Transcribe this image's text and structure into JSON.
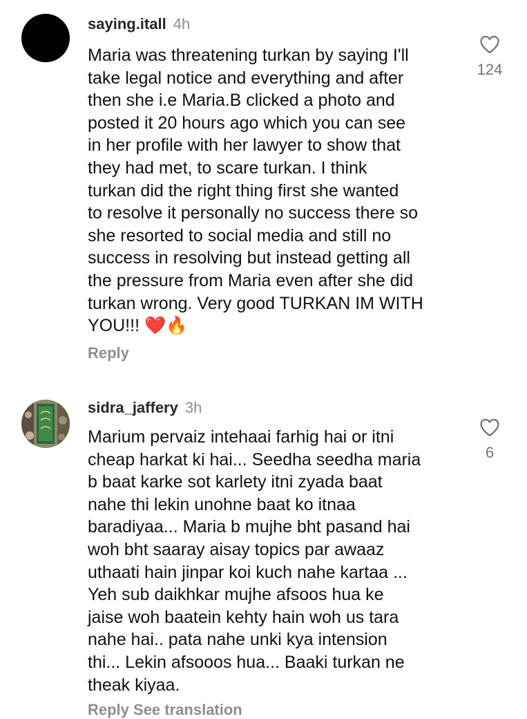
{
  "comments": [
    {
      "username": "saying.itall",
      "time": "4h",
      "avatar_color": "#000000",
      "lines": [
        "Maria was threatening turkan by saying I'll",
        "take legal notice and everything and after",
        "then she i.e Maria.B clicked a photo and",
        "posted it 20 hours ago which you can see",
        "in her profile with her lawyer to show that",
        "they had met, to scare turkan. I think",
        "turkan did the right thing first she wanted",
        "to resolve it personally no success there so",
        "she resorted to social media and still no",
        "success in resolving but instead getting all",
        "the pressure from Maria even after she did",
        "turkan wrong. Very good TURKAN IM WITH",
        "YOU!!! ❤️🔥"
      ],
      "reply_label": "Reply",
      "like_icon": "heart-outline-icon",
      "like_count": "124"
    },
    {
      "username": "sidra_jaffery",
      "time": "3h",
      "avatar_color": "#4a6b3a",
      "lines": [
        "Marium pervaiz intehaai farhig hai or itni",
        "cheap harkat ki hai... Seedha seedha maria",
        "b baat karke sot karlety itni zyada baat",
        "nahe thi lekin unohne baat ko itnaa",
        "baradiyaa... Maria b mujhe bht pasand hai",
        "woh bht saaray aisay topics par awaaz",
        "uthaati hain jinpar koi kuch nahe kartaa ...",
        "Yeh sub daikhkar mujhe afsoos hua ke",
        "jaise woh baatein kehty hain woh us tara",
        "nahe hai.. pata nahe unki kya intension",
        "thi... Lekin afsooos hua... Baaki turkan ne",
        "theak kiyaa."
      ],
      "like_icon": "heart-outline-icon",
      "like_count": "6"
    }
  ],
  "footer_cut_text": "Reply   See translation"
}
